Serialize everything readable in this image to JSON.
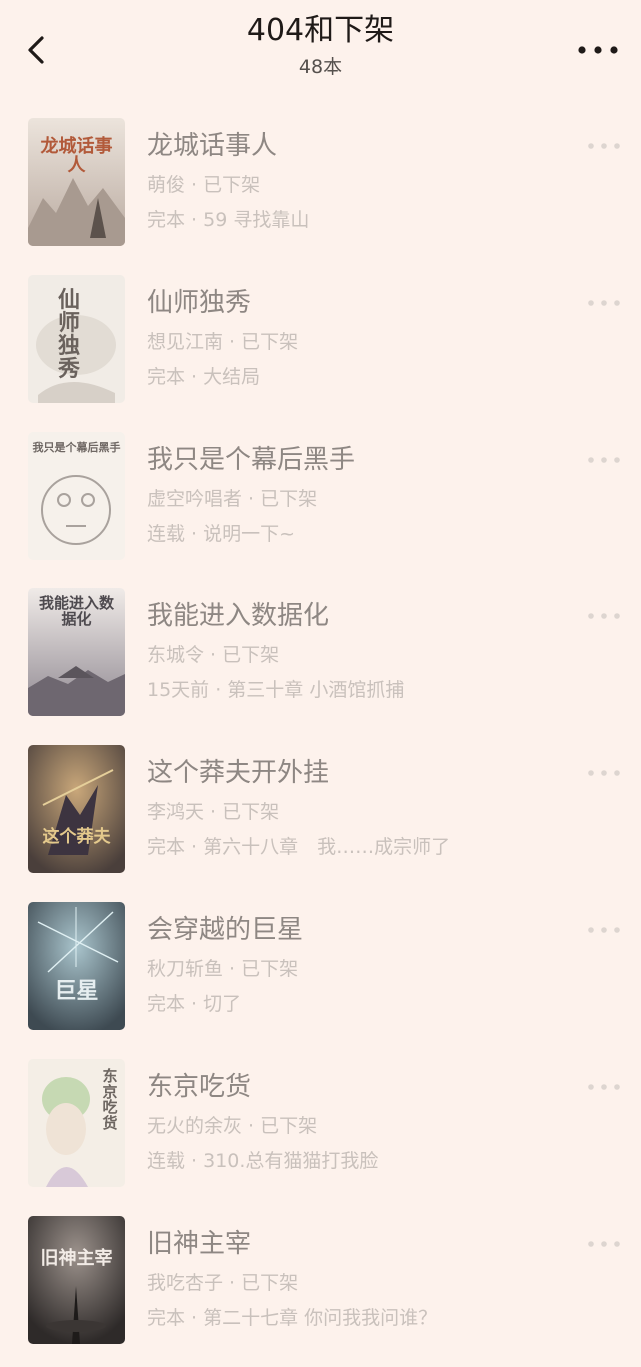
{
  "header": {
    "title": "404和下架",
    "count": "48本"
  },
  "books": [
    {
      "title": "龙城话事人",
      "meta": "萌俊 · 已下架",
      "chapter": "完本 · 59 寻找靠山",
      "cover_text": "龙城话事人",
      "cover_color": "#a8856e"
    },
    {
      "title": "仙师独秀",
      "meta": "想见江南 · 已下架",
      "chapter": "完本 · 大结局",
      "cover_text": "仙师独秀",
      "cover_color": "#e6e0d8"
    },
    {
      "title": "我只是个幕后黑手",
      "meta": "虚空吟唱者 · 已下架",
      "chapter": "连载 · 说明一下~",
      "cover_text": "我只是个幕后黑手",
      "cover_color": "#f3ede6"
    },
    {
      "title": "我能进入数据化",
      "meta": "东城令 · 已下架",
      "chapter": "15天前 · 第三十章 小酒馆抓捕",
      "cover_text": "我能进入数据化",
      "cover_color": "#d9d4d8"
    },
    {
      "title": "这个莽夫开外挂",
      "meta": "李鸿天 · 已下架",
      "chapter": "完本 · 第六十八章　我……成宗师了",
      "cover_text": "这个莽夫",
      "cover_color": "#6b5f58"
    },
    {
      "title": "会穿越的巨星",
      "meta": "秋刀斩鱼 · 已下架",
      "chapter": "完本 · 切了",
      "cover_text": "巨星",
      "cover_color": "#5c6a72"
    },
    {
      "title": "东京吃货",
      "meta": "无火的余灰 · 已下架",
      "chapter": "连载 · 310.总有猫猫打我脸",
      "cover_text": "东京吃货",
      "cover_color": "#efe8dc"
    },
    {
      "title": "旧神主宰",
      "meta": "我吃杏子 · 已下架",
      "chapter": "完本 · 第二十七章 你问我我问谁？",
      "cover_text": "旧神主宰",
      "cover_color": "#4e4a48"
    }
  ],
  "colors": {
    "background": "#fdf2ec",
    "title": "#1f1a18",
    "book_title": "#8e8783",
    "meta": "#c9c1bc"
  },
  "icons": {
    "back": "chevron-left-icon",
    "more": "more-horizontal-icon"
  }
}
